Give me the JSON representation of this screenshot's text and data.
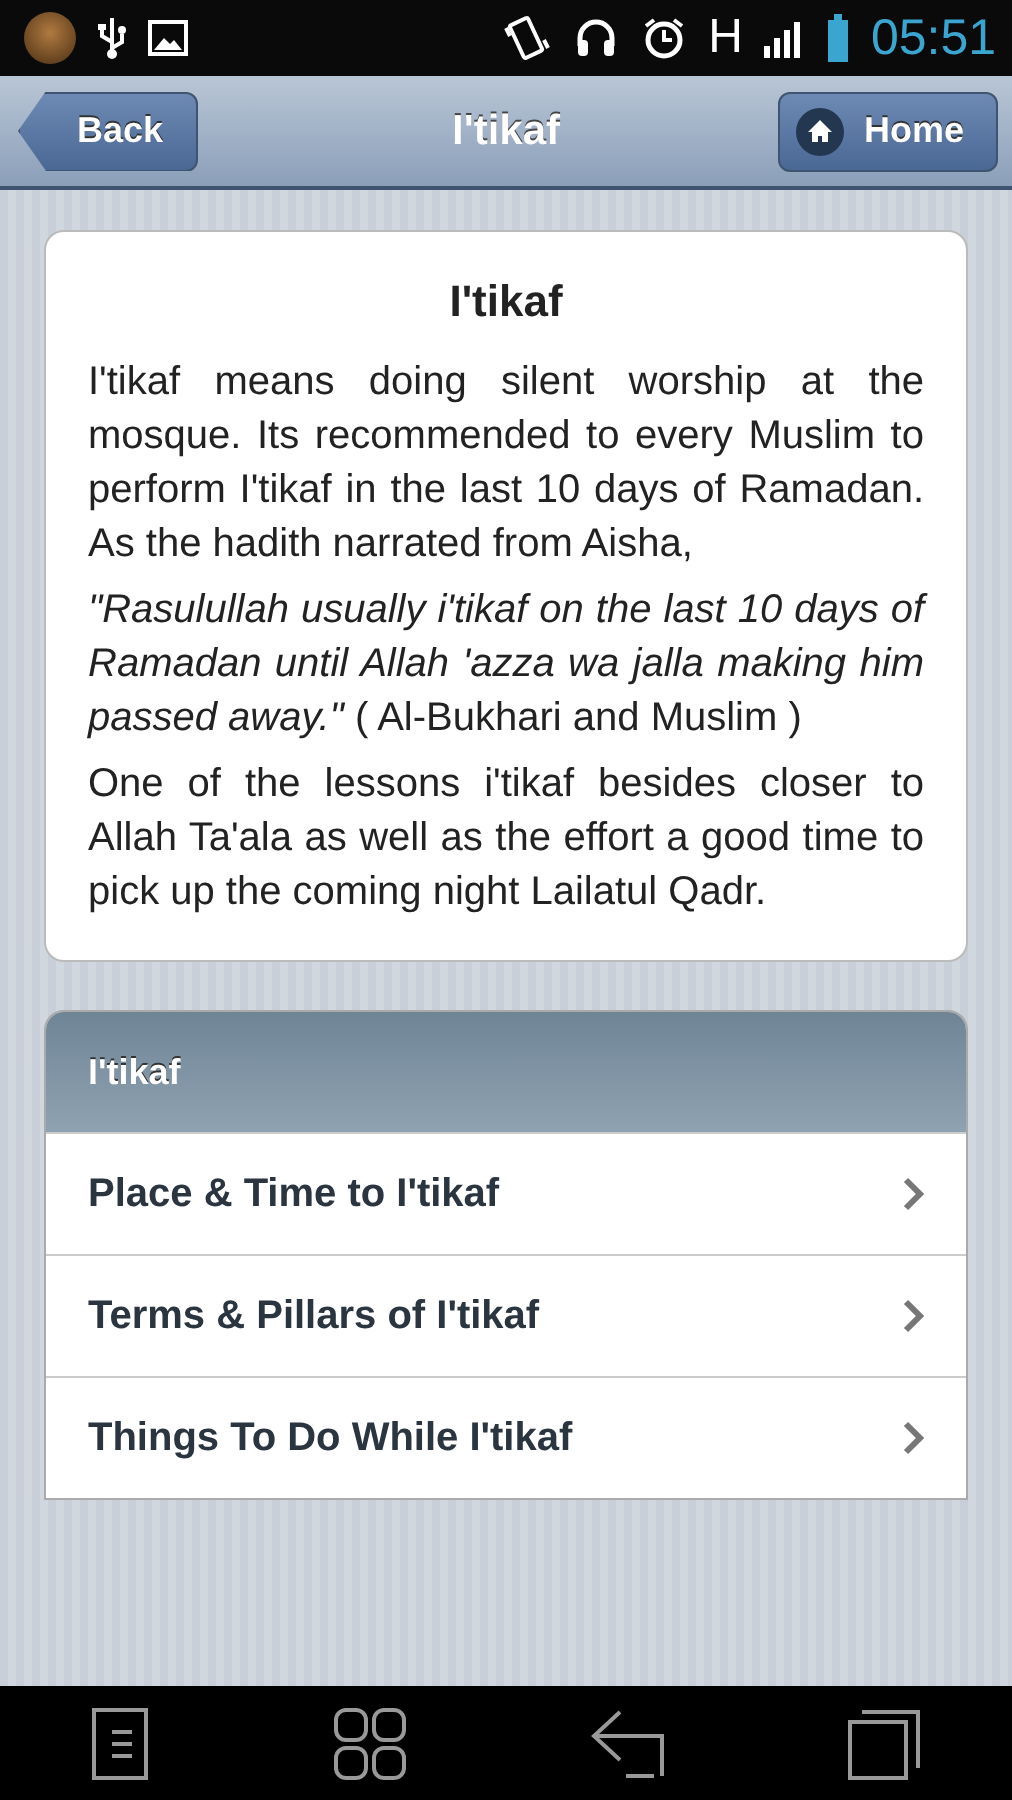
{
  "status_bar": {
    "network": "H",
    "time": "05:51"
  },
  "header": {
    "back": "Back",
    "title": "I'tikaf",
    "home": "Home"
  },
  "article": {
    "title": "I'tikaf",
    "paragraphs": [
      "I'tikaf means doing silent worship at the mosque. Its recommended to every Muslim to perform I'tikaf in the last 10 days of Ramadan. As the hadith narrated from Aisha,",
      "*\"Rasulullah usually i'tikaf on the last 10 days of Ramadan until Allah 'azza wa jalla making him passed away.\"* ( Al-Bukhari and Muslim )",
      "One of the lessons i'tikaf besides closer to Allah Ta'ala as well as the effort a good time to pick up the coming night Lailatul Qadr."
    ]
  },
  "menu": {
    "title": "I'tikaf",
    "items": [
      {
        "label": "Place & Time to I'tikaf"
      },
      {
        "label": "Terms & Pillars of I'tikaf"
      },
      {
        "label": "Things To Do While I'tikaf"
      }
    ]
  }
}
